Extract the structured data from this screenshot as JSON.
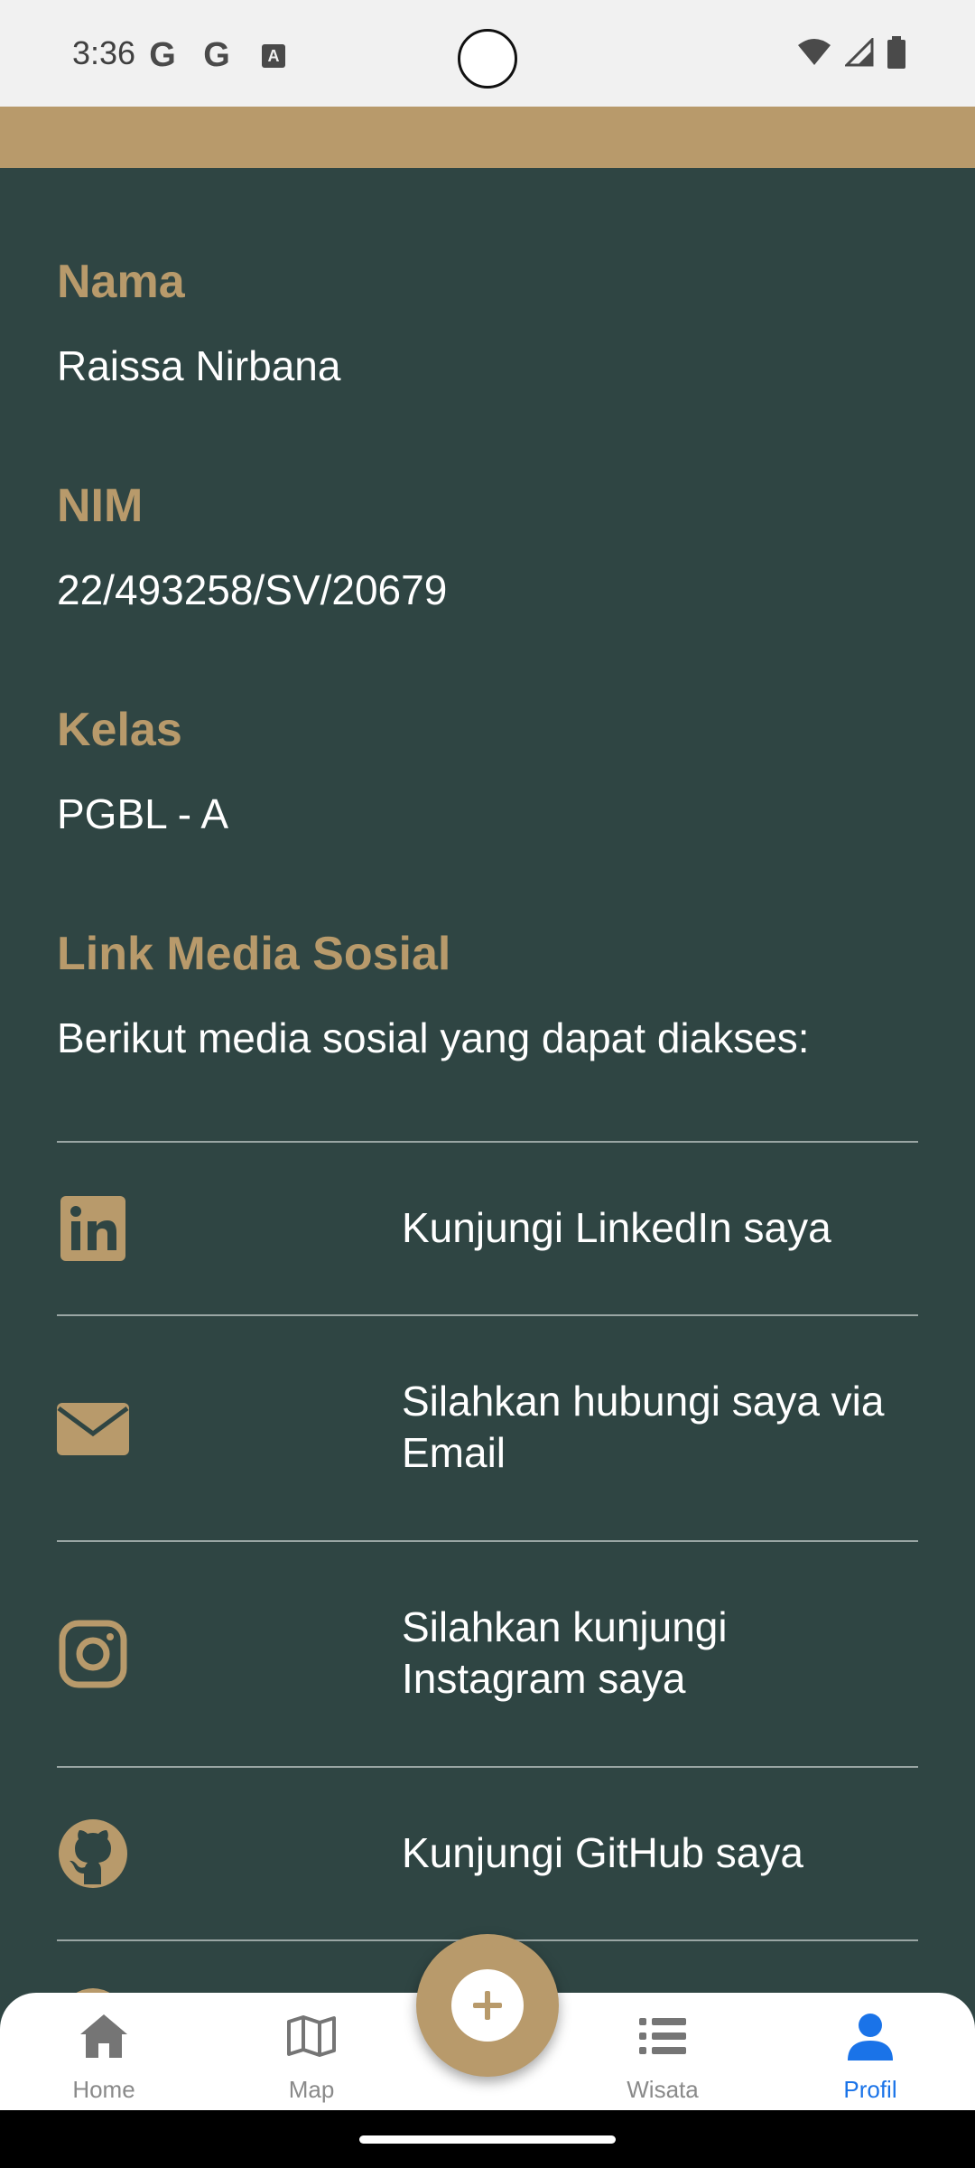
{
  "status_bar": {
    "time": "3:36",
    "left_icons": [
      "G",
      "G",
      "A"
    ],
    "right_icons": [
      "wifi-icon",
      "signal-icon",
      "battery-icon"
    ]
  },
  "profile": {
    "fields": [
      {
        "label": "Nama",
        "value": "Raissa Nirbana"
      },
      {
        "label": "NIM",
        "value": "22/493258/SV/20679"
      },
      {
        "label": "Kelas",
        "value": "PGBL - A"
      }
    ],
    "social_section": {
      "title": "Link Media Sosial",
      "subtitle": "Berikut media sosial yang dapat diakses:"
    },
    "social_links": [
      {
        "icon": "linkedin-icon",
        "text": "Kunjungi LinkedIn saya"
      },
      {
        "icon": "email-icon",
        "text": "Silahkan hubungi saya via Email"
      },
      {
        "icon": "instagram-icon",
        "text": "Silahkan kunjungi Instagram saya"
      },
      {
        "icon": "github-icon",
        "text": "Kunjungi GitHub saya"
      }
    ]
  },
  "bottom_nav": {
    "items": [
      {
        "label": "Home",
        "icon": "home-icon"
      },
      {
        "label": "Map",
        "icon": "map-icon"
      },
      {
        "label": "Wisata",
        "icon": "list-icon"
      },
      {
        "label": "Profil",
        "icon": "person-icon",
        "active": true
      }
    ],
    "fab_icon": "plus-icon"
  },
  "colors": {
    "background": "#2f4543",
    "accent": "#b89a6b",
    "text": "#ffffff",
    "nav_active": "#1a73e8",
    "nav_inactive": "#8a8a8a"
  }
}
